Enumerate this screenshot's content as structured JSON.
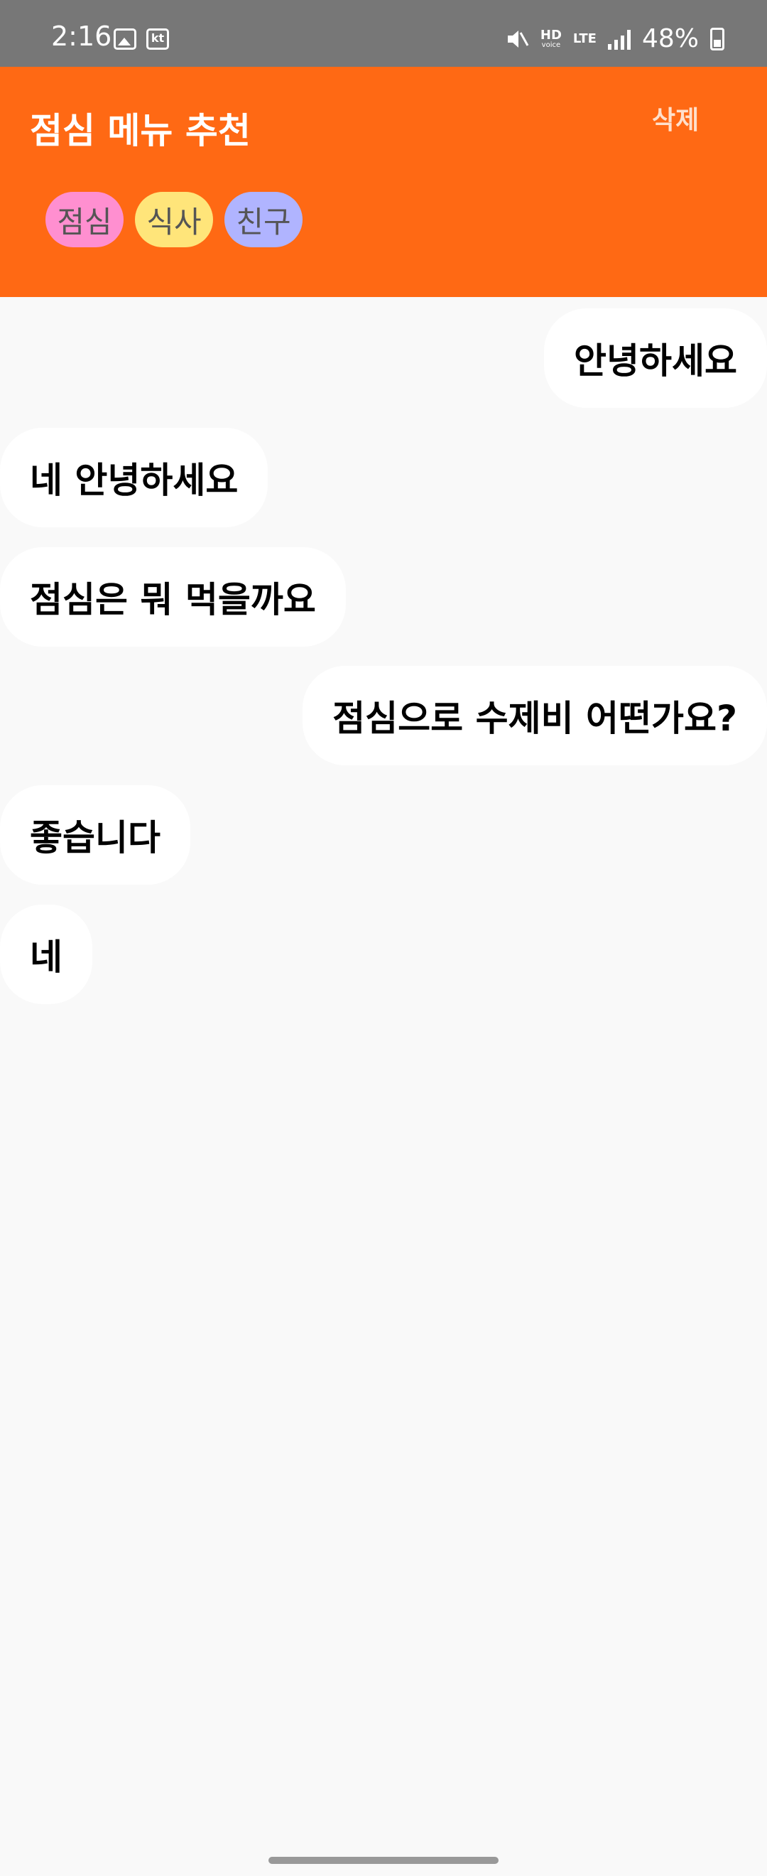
{
  "status_bar": {
    "time": "2:16",
    "carrier_badge": "kt",
    "network_hd": "HD",
    "network_voice": "voice",
    "network_type": "LTE",
    "battery": "48%"
  },
  "header": {
    "title": "점심 메뉴 추천",
    "delete_label": "삭제",
    "tags": [
      {
        "label": "점심",
        "color": "#ff8fd0"
      },
      {
        "label": "식사",
        "color": "#ffe57a"
      },
      {
        "label": "친구",
        "color": "#b0b4ff"
      }
    ]
  },
  "messages": [
    {
      "text": "안녕하세요",
      "side": "right"
    },
    {
      "text": "네 안녕하세요",
      "side": "left"
    },
    {
      "text": "점심은 뭐 먹을까요",
      "side": "left"
    },
    {
      "text": "점심으로 수제비 어떤가요?",
      "side": "right"
    },
    {
      "text": "좋습니다",
      "side": "left"
    },
    {
      "text": "네",
      "side": "left"
    }
  ]
}
